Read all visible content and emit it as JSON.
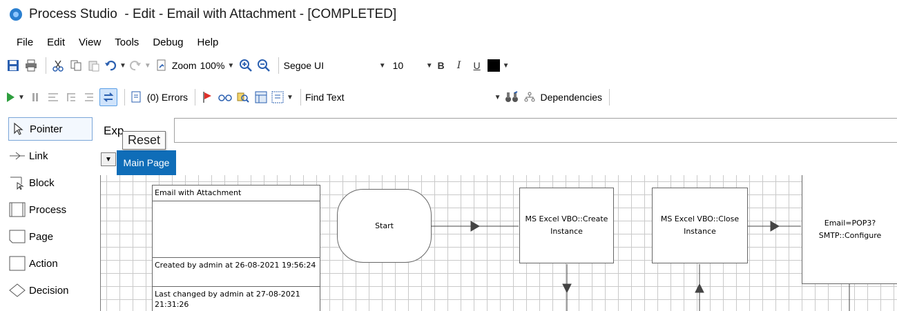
{
  "window": {
    "title": "Process Studio  - Edit - Email with Attachment - [COMPLETED]"
  },
  "menu": [
    "File",
    "Edit",
    "View",
    "Tools",
    "Debug",
    "Help"
  ],
  "toolbar1": {
    "zoom_label": "Zoom",
    "zoom_value": "100%",
    "font_name": "Segoe UI",
    "font_size": "10",
    "bold": "B",
    "italic": "I",
    "underline": "U",
    "text_color": "#000000"
  },
  "toolbar2": {
    "errors_label": "(0) Errors",
    "find_label": "Find Text",
    "find_value": "",
    "dependencies_label": "Dependencies"
  },
  "palette": [
    "Pointer",
    "Link",
    "Block",
    "Process",
    "Page",
    "Action",
    "Decision"
  ],
  "expression": {
    "label": "Exp",
    "value": "",
    "tooltip": "Reset"
  },
  "page_tabs": [
    "Main Page"
  ],
  "diagram": {
    "info": {
      "name": "Email with Attachment",
      "description": "",
      "created": "Created by admin at 26-08-2021 19:56:24",
      "changed": "Last changed by admin at 27-08-2021 21:31:26"
    },
    "start": "Start",
    "nodes": [
      "MS Excel VBO::Create Instance",
      "MS Excel VBO::Close Instance",
      "Email=POP3? SMTP::Configure"
    ]
  },
  "colors": {
    "accent": "#0f6db8",
    "toggle_active": "#cfe3fb",
    "run_green": "#2e9e3e",
    "breakpoint_red": "#e0302a"
  }
}
